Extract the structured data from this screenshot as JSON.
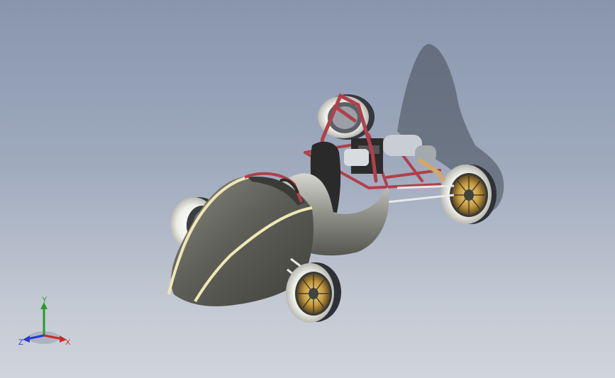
{
  "viewport": {
    "background_top": "#8895ad",
    "background_bottom": "#d0d4db"
  },
  "model": {
    "frame_color": "#b0404a",
    "body_color": "#707168",
    "stripe_color": "#efe8b4",
    "tire_color": "#f2f2ee",
    "rim_color": "#d9b35a"
  },
  "triad": {
    "y_label": "Y",
    "x_label": "X",
    "z_label": "Z",
    "y_color": "#2a9a2a",
    "x_color": "#cc2a2a",
    "z_color": "#2a3acc"
  }
}
